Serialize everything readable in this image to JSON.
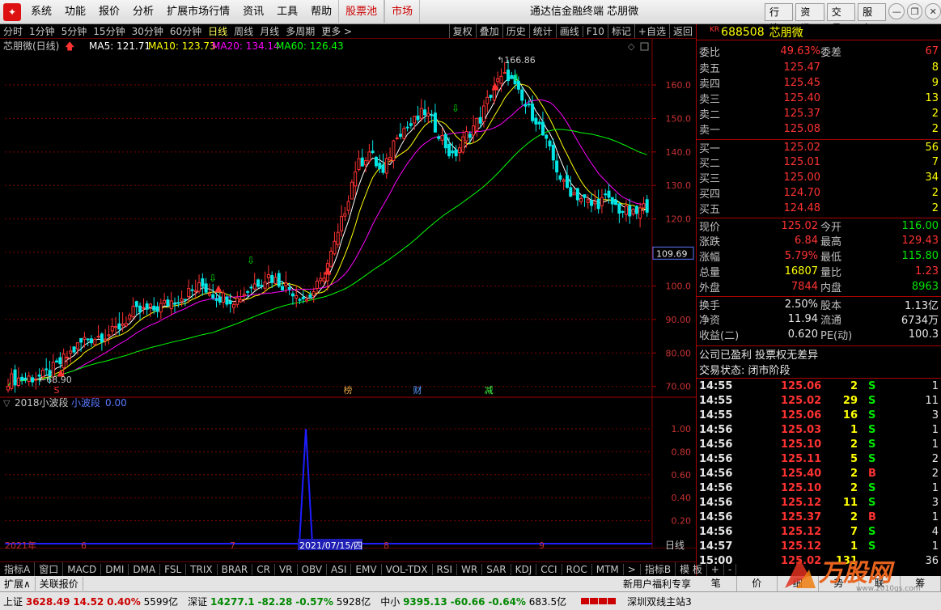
{
  "menubar": {
    "items": [
      "系统",
      "功能",
      "报价",
      "分析",
      "扩展市场行情",
      "资讯",
      "工具",
      "帮助",
      "股票池",
      "市场"
    ],
    "app_title": "通达信金融终端  芯朋微",
    "right_buttons": [
      "行情",
      "资讯",
      "交易",
      "服务"
    ]
  },
  "toolbar": {
    "items": [
      "分时",
      "1分钟",
      "5分钟",
      "15分钟",
      "30分钟",
      "60分钟",
      "日线",
      "周线",
      "月线",
      "多周期",
      "更多 >"
    ],
    "active": "日线",
    "right_items": [
      "复权",
      "叠加",
      "历史",
      "统计",
      "画线",
      "F10",
      "标记",
      "+自选",
      "返回"
    ]
  },
  "chart_header": {
    "name": "芯朋微(日线)",
    "ma5": "MA5: 121.71",
    "ma10": "MA10: 123.73",
    "ma20": "MA20: 134.14",
    "ma60": "MA60: 126.43"
  },
  "chart_data": {
    "type": "candlestick",
    "y_ticks": [
      "160.0",
      "150.0",
      "140.0",
      "130.0",
      "120.0",
      "110.0",
      "100.0",
      "90.00",
      "80.00",
      "70.00"
    ],
    "ylim": [
      68,
      167
    ],
    "high_label": "166.86",
    "low_label": "68.90",
    "current_price_label": "109.69",
    "x_labels": [
      "2021年",
      "6",
      "7",
      "2021/07/15/四",
      "8",
      "9"
    ],
    "event_markers": [
      "S",
      "榜",
      "财",
      "减"
    ],
    "sub_title": "2018小波段",
    "sub_series_name": "小波段",
    "sub_value": "0.00",
    "sub_y_ticks": [
      "1.00",
      "0.80",
      "0.60",
      "0.40",
      "0.20"
    ],
    "sub_spike_label": "2021/07/15/四",
    "sub_spike_value": 1.0,
    "period_label": "日线"
  },
  "quote": {
    "code_prefix": "KR",
    "code": "688508",
    "name": "芯朋微",
    "ratio_label": "委比",
    "ratio": "49.63%",
    "diff_label": "委差",
    "diff": "67",
    "asks": [
      {
        "label": "卖五",
        "price": "125.47",
        "vol": "8"
      },
      {
        "label": "卖四",
        "price": "125.45",
        "vol": "9"
      },
      {
        "label": "卖三",
        "price": "125.40",
        "vol": "13"
      },
      {
        "label": "卖二",
        "price": "125.37",
        "vol": "2"
      },
      {
        "label": "卖一",
        "price": "125.08",
        "vol": "2"
      }
    ],
    "bids": [
      {
        "label": "买一",
        "price": "125.02",
        "vol": "56"
      },
      {
        "label": "买二",
        "price": "125.01",
        "vol": "7"
      },
      {
        "label": "买三",
        "price": "125.00",
        "vol": "34"
      },
      {
        "label": "买四",
        "price": "124.70",
        "vol": "2"
      },
      {
        "label": "买五",
        "price": "124.48",
        "vol": "2"
      }
    ],
    "stats": [
      {
        "l1": "现价",
        "v1": "125.02",
        "c1": "red",
        "l2": "今开",
        "v2": "116.00",
        "c2": "grn"
      },
      {
        "l1": "涨跌",
        "v1": "6.84",
        "c1": "red",
        "l2": "最高",
        "v2": "129.43",
        "c2": "red"
      },
      {
        "l1": "涨幅",
        "v1": "5.79%",
        "c1": "red",
        "l2": "最低",
        "v2": "115.80",
        "c2": "grn"
      },
      {
        "l1": "总量",
        "v1": "16807",
        "c1": "yel",
        "l2": "量比",
        "v2": "1.23",
        "c2": "red"
      },
      {
        "l1": "外盘",
        "v1": "7844",
        "c1": "red",
        "l2": "内盘",
        "v2": "8963",
        "c2": "grn"
      }
    ],
    "stats2": [
      {
        "l1": "换手",
        "v1": "2.50%",
        "l2": "股本",
        "v2": "1.13亿"
      },
      {
        "l1": "净资",
        "v1": "11.94",
        "l2": "流通",
        "v2": "6734万"
      },
      {
        "l1": "收益(二)",
        "v1": "0.620",
        "l2": "PE(动)",
        "v2": "100.3"
      }
    ],
    "note1": "公司已盈利 投票权无差异",
    "note2": "交易状态: 闭市阶段"
  },
  "ticks": [
    {
      "t": "14:55",
      "p": "125.06",
      "v": "2",
      "f": "S",
      "n": "1",
      "c": "red"
    },
    {
      "t": "14:55",
      "p": "125.02",
      "v": "29",
      "f": "S",
      "n": "11",
      "c": "red"
    },
    {
      "t": "14:55",
      "p": "125.06",
      "v": "16",
      "f": "S",
      "n": "3",
      "c": "red"
    },
    {
      "t": "14:56",
      "p": "125.03",
      "v": "1",
      "f": "S",
      "n": "1",
      "c": "red"
    },
    {
      "t": "14:56",
      "p": "125.10",
      "v": "2",
      "f": "S",
      "n": "1",
      "c": "red"
    },
    {
      "t": "14:56",
      "p": "125.11",
      "v": "5",
      "f": "S",
      "n": "2",
      "c": "red"
    },
    {
      "t": "14:56",
      "p": "125.40",
      "v": "2",
      "f": "B",
      "n": "2",
      "c": "red"
    },
    {
      "t": "14:56",
      "p": "125.10",
      "v": "2",
      "f": "S",
      "n": "1",
      "c": "red"
    },
    {
      "t": "14:56",
      "p": "125.12",
      "v": "11",
      "f": "S",
      "n": "3",
      "c": "red"
    },
    {
      "t": "14:56",
      "p": "125.37",
      "v": "2",
      "f": "B",
      "n": "1",
      "c": "red"
    },
    {
      "t": "14:56",
      "p": "125.12",
      "v": "7",
      "f": "S",
      "n": "4",
      "c": "red"
    },
    {
      "t": "14:57",
      "p": "125.12",
      "v": "1",
      "f": "S",
      "n": "1",
      "c": "red"
    },
    {
      "t": "15:00",
      "p": "125.02",
      "v": "131",
      "f": "",
      "n": "36",
      "c": "red"
    }
  ],
  "bottom_tabs": [
    "指标A",
    "窗口",
    "MACD",
    "DMI",
    "DMA",
    "FSL",
    "TRIX",
    "BRAR",
    "CR",
    "VR",
    "OBV",
    "ASI",
    "EMV",
    "VOL-TDX",
    "RSI",
    "WR",
    "SAR",
    "KDJ",
    "CCI",
    "ROC",
    "MTM",
    ">",
    "指标B",
    "模 板",
    "+",
    "-"
  ],
  "bottom_tabs2": [
    "扩展∧",
    "关联报价"
  ],
  "promo": "新用户福利专享",
  "right_bottom_tabs": [
    "笔",
    "价",
    "细",
    "势",
    "联",
    "筹"
  ],
  "status": [
    {
      "name": "上证",
      "val": "3628.49",
      "chg": "14.52",
      "pct": "0.40%",
      "amt": "5599亿",
      "c": "red"
    },
    {
      "name": "深证",
      "val": "14277.1",
      "chg": "-82.28",
      "pct": "-0.57%",
      "amt": "5928亿",
      "c": "grn"
    },
    {
      "name": "中小",
      "val": "9395.13",
      "chg": "-60.66",
      "pct": "-0.64%",
      "amt": "683.5亿",
      "c": "grn"
    }
  ],
  "server": "深圳双线主站3",
  "watermark": {
    "text": "万股网",
    "url": "www.2010gs.com"
  },
  "colors": {
    "up": "#ff3232",
    "down": "#00e6e6",
    "ma5": "#ffffff",
    "ma10": "#ffff00",
    "ma20": "#ff00ff",
    "ma60": "#00ff00",
    "grid": "#800000"
  }
}
